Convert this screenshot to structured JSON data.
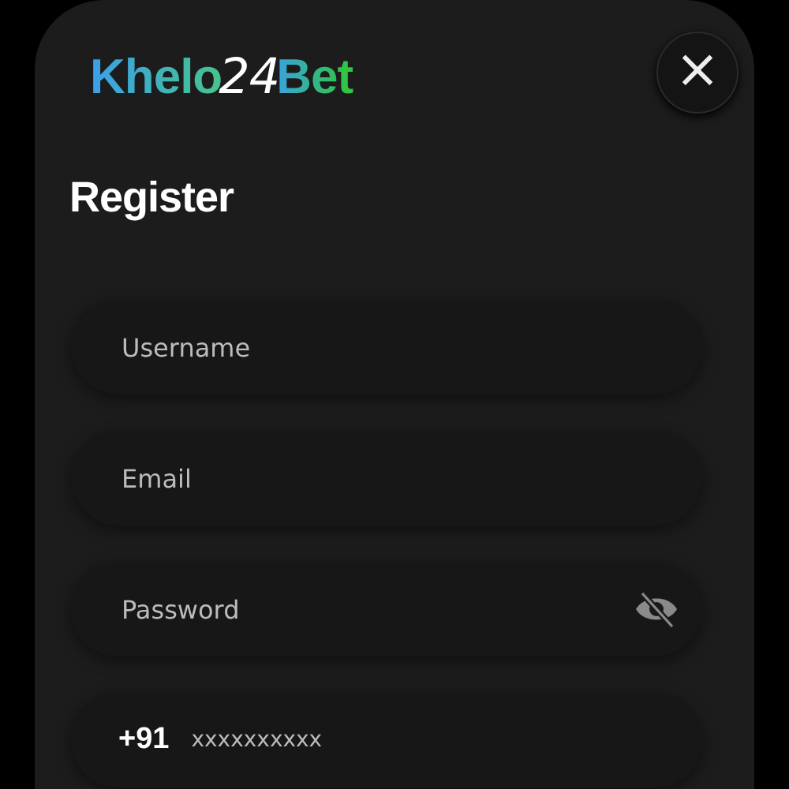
{
  "logo": {
    "parts": [
      {
        "text": "Khelo",
        "kind": "plain"
      },
      {
        "text": "24",
        "kind": "script"
      },
      {
        "text": "Bet",
        "kind": "plain"
      }
    ]
  },
  "close_button": {
    "label": "×"
  },
  "title": "Register",
  "fields": [
    {
      "kind": "text",
      "placeholder": "Username"
    },
    {
      "kind": "text",
      "placeholder": "Email"
    },
    {
      "kind": "password",
      "placeholder": "Password"
    },
    {
      "kind": "phone",
      "prefix": "+91",
      "placeholder": "xxxxxxxxxx"
    }
  ]
}
